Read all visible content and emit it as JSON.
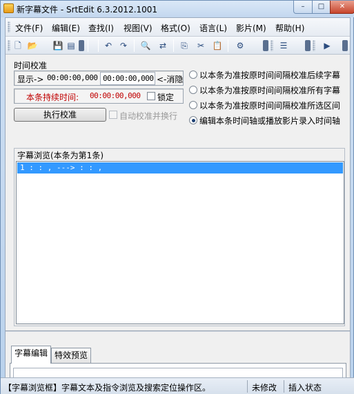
{
  "window": {
    "title": "新字幕文件 - SrtEdit 6.3.2012.1001",
    "min_glyph": "–",
    "max_glyph": "□",
    "close_glyph": "✕"
  },
  "menu": {
    "items": [
      "文件(F)",
      "编辑(E)",
      "查找(I)",
      "视图(V)",
      "格式(O)",
      "语言(L)",
      "影片(M)",
      "帮助(H)"
    ]
  },
  "toolbar": {
    "icons": [
      "new-file-icon",
      "open-folder-icon",
      "save-icon",
      "print-icon",
      "undo-icon",
      "redo-icon",
      "find-icon",
      "replace-icon",
      "copy-icon",
      "cut-icon",
      "paste-icon",
      "settings-icon",
      "list-icon",
      "play-icon"
    ],
    "glyphs": {
      "new": "🗋",
      "open": "📂",
      "save": "💾",
      "print": "▤",
      "undo": "↶",
      "redo": "↷",
      "find": "🔍",
      "replace": "⇄",
      "copy": "⎘",
      "cut": "✂",
      "paste": "📋",
      "settings": "⚙",
      "list": "☰",
      "play": "▶"
    }
  },
  "calibration": {
    "section_label": "时间校准",
    "display_label": "显示->",
    "start_time": "00:00:00,000",
    "end_time": "00:00:00,000",
    "hide_label": "<-消隐",
    "duration_label": "本条持续时间:",
    "duration_value": "00:00:00,000",
    "lock_label": "锁定",
    "execute_button": "执行校准",
    "auto_wrap_label": "自动校准并换行",
    "radio_options": [
      "以本条为准按原时间间隔校准后续字幕",
      "以本条为准按原时间间隔校准所有字幕",
      "以本条为准按原时间间隔校准所选区间",
      "编辑本条时间轴或播放影片录入时间轴"
    ],
    "selected_option": 3
  },
  "browse": {
    "section_label": "字幕浏览(本条为第1条)",
    "selected_row": "1    :  :  ,  ---> :  :  ,"
  },
  "tabs": {
    "items": [
      "字幕编辑",
      "特效预览"
    ],
    "active": 0
  },
  "status": {
    "hint": "【字幕浏览框】字幕文本及指令浏览及搜索定位操作区。",
    "modified": "未修改",
    "mode": "插入状态"
  },
  "colors": {
    "selection": "#3399ff",
    "duration_label": "#c00000"
  }
}
